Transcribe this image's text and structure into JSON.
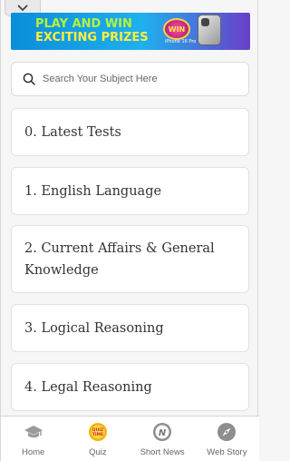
{
  "banner": {
    "line1": "PLAY AND WIN",
    "line2": "EXCITING PRIZES",
    "badge": "WIN",
    "phone_tag": "iPhone 16 Pro"
  },
  "search": {
    "placeholder": "Search Your Subject Here"
  },
  "subjects": [
    {
      "label": "0. Latest Tests"
    },
    {
      "label": "1. English Language"
    },
    {
      "label": "2. Current Affairs & General Knowledge"
    },
    {
      "label": "3. Logical Reasoning"
    },
    {
      "label": "4. Legal Reasoning"
    }
  ],
  "nav": {
    "items": [
      {
        "label": "Home",
        "icon": "graduation-cap-icon"
      },
      {
        "label": "Quiz",
        "icon": "quiz-time-icon",
        "badge": "QUIZ TIME"
      },
      {
        "label": "Short News",
        "icon": "news-icon",
        "badge": "N"
      },
      {
        "label": "Web Story",
        "icon": "compass-icon"
      }
    ]
  },
  "colors": {
    "background": "#f6f6f6",
    "card": "#ffffff",
    "text": "#333333",
    "nav_text": "#666666",
    "quiz_yellow": "#f5b400"
  }
}
